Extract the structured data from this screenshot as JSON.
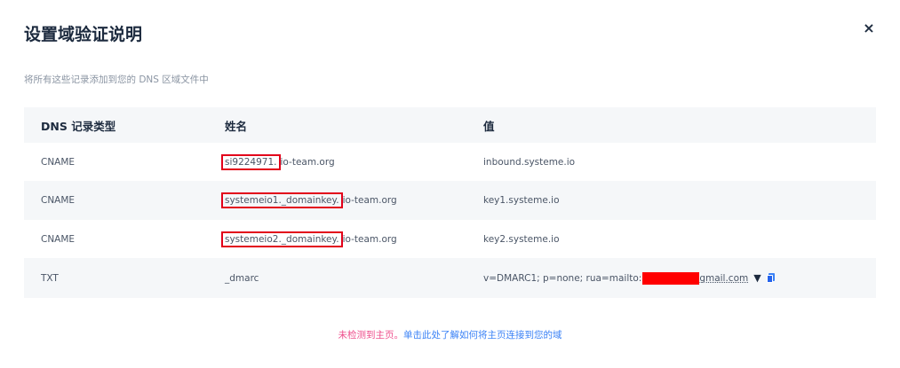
{
  "dialog": {
    "title": "设置域验证说明",
    "close_icon": "×",
    "subtitle": "将所有这些记录添加到您的 DNS 区域文件中"
  },
  "table": {
    "headers": [
      "DNS 记录类型",
      "姓名",
      "值"
    ],
    "rows": [
      {
        "type": "CNAME",
        "name_prefix": "si9224971.",
        "name_suffix": "io-team.org",
        "value": "inbound.systeme.io"
      },
      {
        "type": "CNAME",
        "name_prefix": "systemeio1._domainkey.",
        "name_suffix": "io-team.org",
        "value": "key1.systeme.io"
      },
      {
        "type": "CNAME",
        "name_prefix": "systemeio2._domainkey.",
        "name_suffix": "io-team.org",
        "value": "key2.systeme.io"
      },
      {
        "type": "TXT",
        "name": "_dmarc",
        "value_prefix": "v=DMARC1; p=none; rua=mailto:",
        "value_suffix": "gmail.com",
        "expand_icon": "chevron-down-icon",
        "copy_icon": "copy-icon"
      }
    ]
  },
  "footer": {
    "warning": "未检测到主页。",
    "link": "单击此处了解如何将主页连接到您的域"
  },
  "colors": {
    "highlight": "#e2001a",
    "redaction": "#ff0000",
    "warning": "#ee4d8b",
    "link": "#3b82f6"
  }
}
